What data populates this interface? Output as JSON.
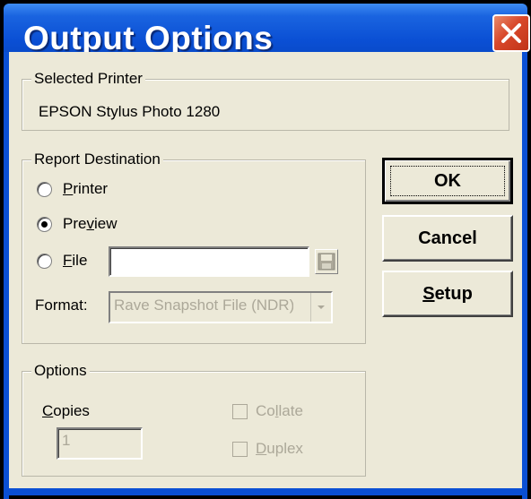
{
  "window": {
    "title": "Output Options"
  },
  "selected_printer": {
    "legend": "Selected Printer",
    "name": "EPSON Stylus Photo 1280"
  },
  "report_destination": {
    "legend": "Report Destination",
    "options": [
      {
        "label": "Printer",
        "mnemonic": "P",
        "rest": "rinter",
        "checked": false
      },
      {
        "label": "Preview",
        "prefix": "Pre",
        "mnemonic": "v",
        "rest": "iew",
        "checked": true
      },
      {
        "label": "File",
        "mnemonic": "F",
        "rest": "ile",
        "checked": false
      }
    ],
    "file_value": "",
    "format_label": "Format:",
    "format_value": "Rave Snapshot File (NDR)"
  },
  "options": {
    "legend": "Options",
    "copies_label_mnemonic": "C",
    "copies_label_rest": "opies",
    "copies_value": "1",
    "collate_prefix": "Co",
    "collate_mnemonic": "l",
    "collate_rest": "late",
    "duplex_mnemonic": "D",
    "duplex_rest": "uplex"
  },
  "buttons": {
    "ok": "OK",
    "cancel": "Cancel",
    "setup_mnemonic": "S",
    "setup_rest": "etup"
  },
  "colors": {
    "title_bar": "#0a4fd4",
    "close_button": "#d8472a",
    "dialog_bg": "#ece9d8"
  },
  "icons": {
    "close": "close-icon",
    "save": "floppy-disk-icon",
    "dropdown": "chevron-down-icon"
  }
}
